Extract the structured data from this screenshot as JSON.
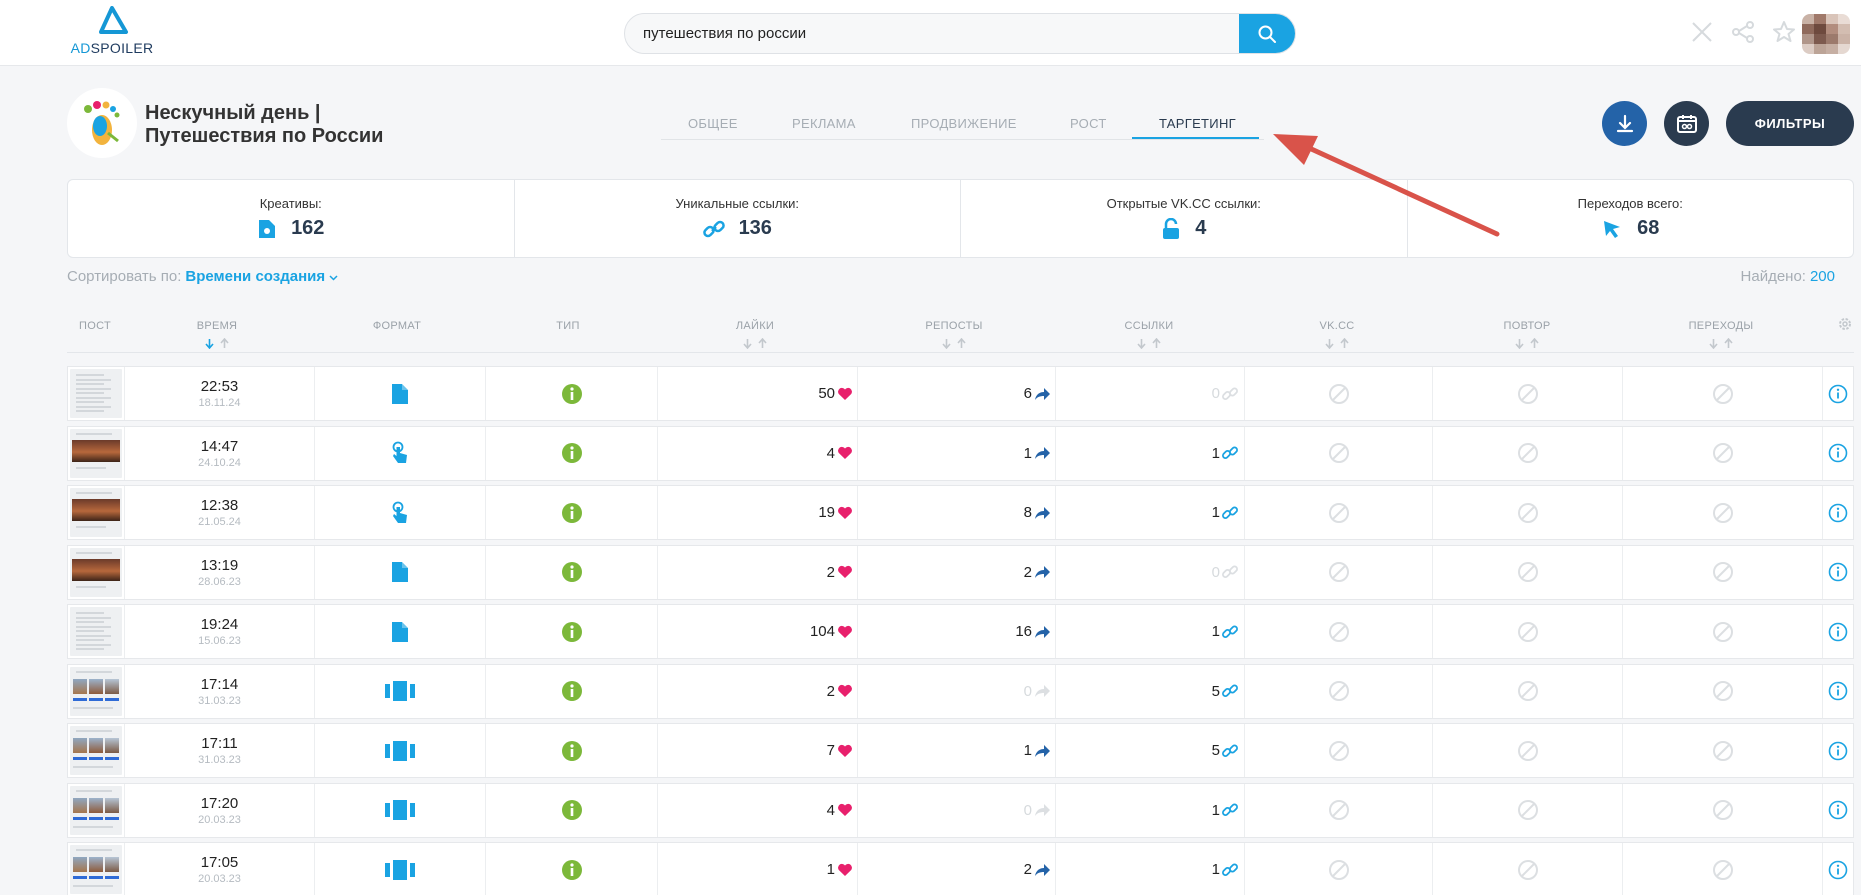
{
  "app": {
    "logo": {
      "ad": "AD",
      "rest": "SPOILER"
    },
    "search": {
      "value": "путешествия по россии",
      "placeholder": ""
    }
  },
  "header": {
    "brand_line1": "Нескучный день |",
    "brand_line2": "Путешествия по России",
    "tabs": [
      "ОБЩЕЕ",
      "РЕКЛАМА",
      "ПРОДВИЖЕНИЕ",
      "РОСТ",
      "ТАРГЕТИНГ"
    ],
    "active_tab": "ТАРГЕТИНГ",
    "filters_label": "ФИЛЬТРЫ"
  },
  "stats": [
    {
      "label": "Креативы:",
      "value": "162",
      "icon": "file-icon"
    },
    {
      "label": "Уникальные ссылки:",
      "value": "136",
      "icon": "link-icon"
    },
    {
      "label": "Открытые VK.CC ссылки:",
      "value": "4",
      "icon": "lock-open-icon"
    },
    {
      "label": "Переходов всего:",
      "value": "68",
      "icon": "cursor-icon"
    }
  ],
  "sort": {
    "label": "Сортировать по:",
    "value": "Времени создания"
  },
  "found": {
    "label": "Найдено:",
    "value": "200"
  },
  "table": {
    "columns": [
      "ПОСТ",
      "ВРЕМЯ",
      "ФОРМАТ",
      "ТИП",
      "ЛАЙКИ",
      "РЕПОСТЫ",
      "ССЫЛКИ",
      "VK.CC",
      "ПОВТОР",
      "ПЕРЕХОДЫ"
    ],
    "rows": [
      {
        "time": "22:53",
        "date": "18.11.24",
        "format": "document",
        "likes": "50",
        "reposts": "6",
        "links": "0",
        "thumb": "text"
      },
      {
        "time": "14:47",
        "date": "24.10.24",
        "format": "tap",
        "likes": "4",
        "reposts": "1",
        "links": "1",
        "thumb": "photo"
      },
      {
        "time": "12:38",
        "date": "21.05.24",
        "format": "tap",
        "likes": "19",
        "reposts": "8",
        "links": "1",
        "thumb": "photo"
      },
      {
        "time": "13:19",
        "date": "28.06.23",
        "format": "document",
        "likes": "2",
        "reposts": "2",
        "links": "0",
        "thumb": "photo"
      },
      {
        "time": "19:24",
        "date": "15.06.23",
        "format": "document",
        "likes": "104",
        "reposts": "16",
        "links": "1",
        "thumb": "text"
      },
      {
        "time": "17:14",
        "date": "31.03.23",
        "format": "carousel",
        "likes": "2",
        "reposts": "0",
        "links": "5",
        "thumb": "carousel"
      },
      {
        "time": "17:11",
        "date": "31.03.23",
        "format": "carousel",
        "likes": "7",
        "reposts": "1",
        "links": "5",
        "thumb": "carousel"
      },
      {
        "time": "17:20",
        "date": "20.03.23",
        "format": "carousel",
        "likes": "4",
        "reposts": "0",
        "links": "1",
        "thumb": "carousel"
      },
      {
        "time": "17:05",
        "date": "20.03.23",
        "format": "carousel",
        "likes": "1",
        "reposts": "2",
        "links": "1",
        "thumb": "carousel"
      }
    ]
  },
  "colors": {
    "accent": "#1aa3e2",
    "dark": "#2a3b4f",
    "like": "#e8206c",
    "type_info": "#7cb83a",
    "annotation_arrow": "#d9534a"
  }
}
